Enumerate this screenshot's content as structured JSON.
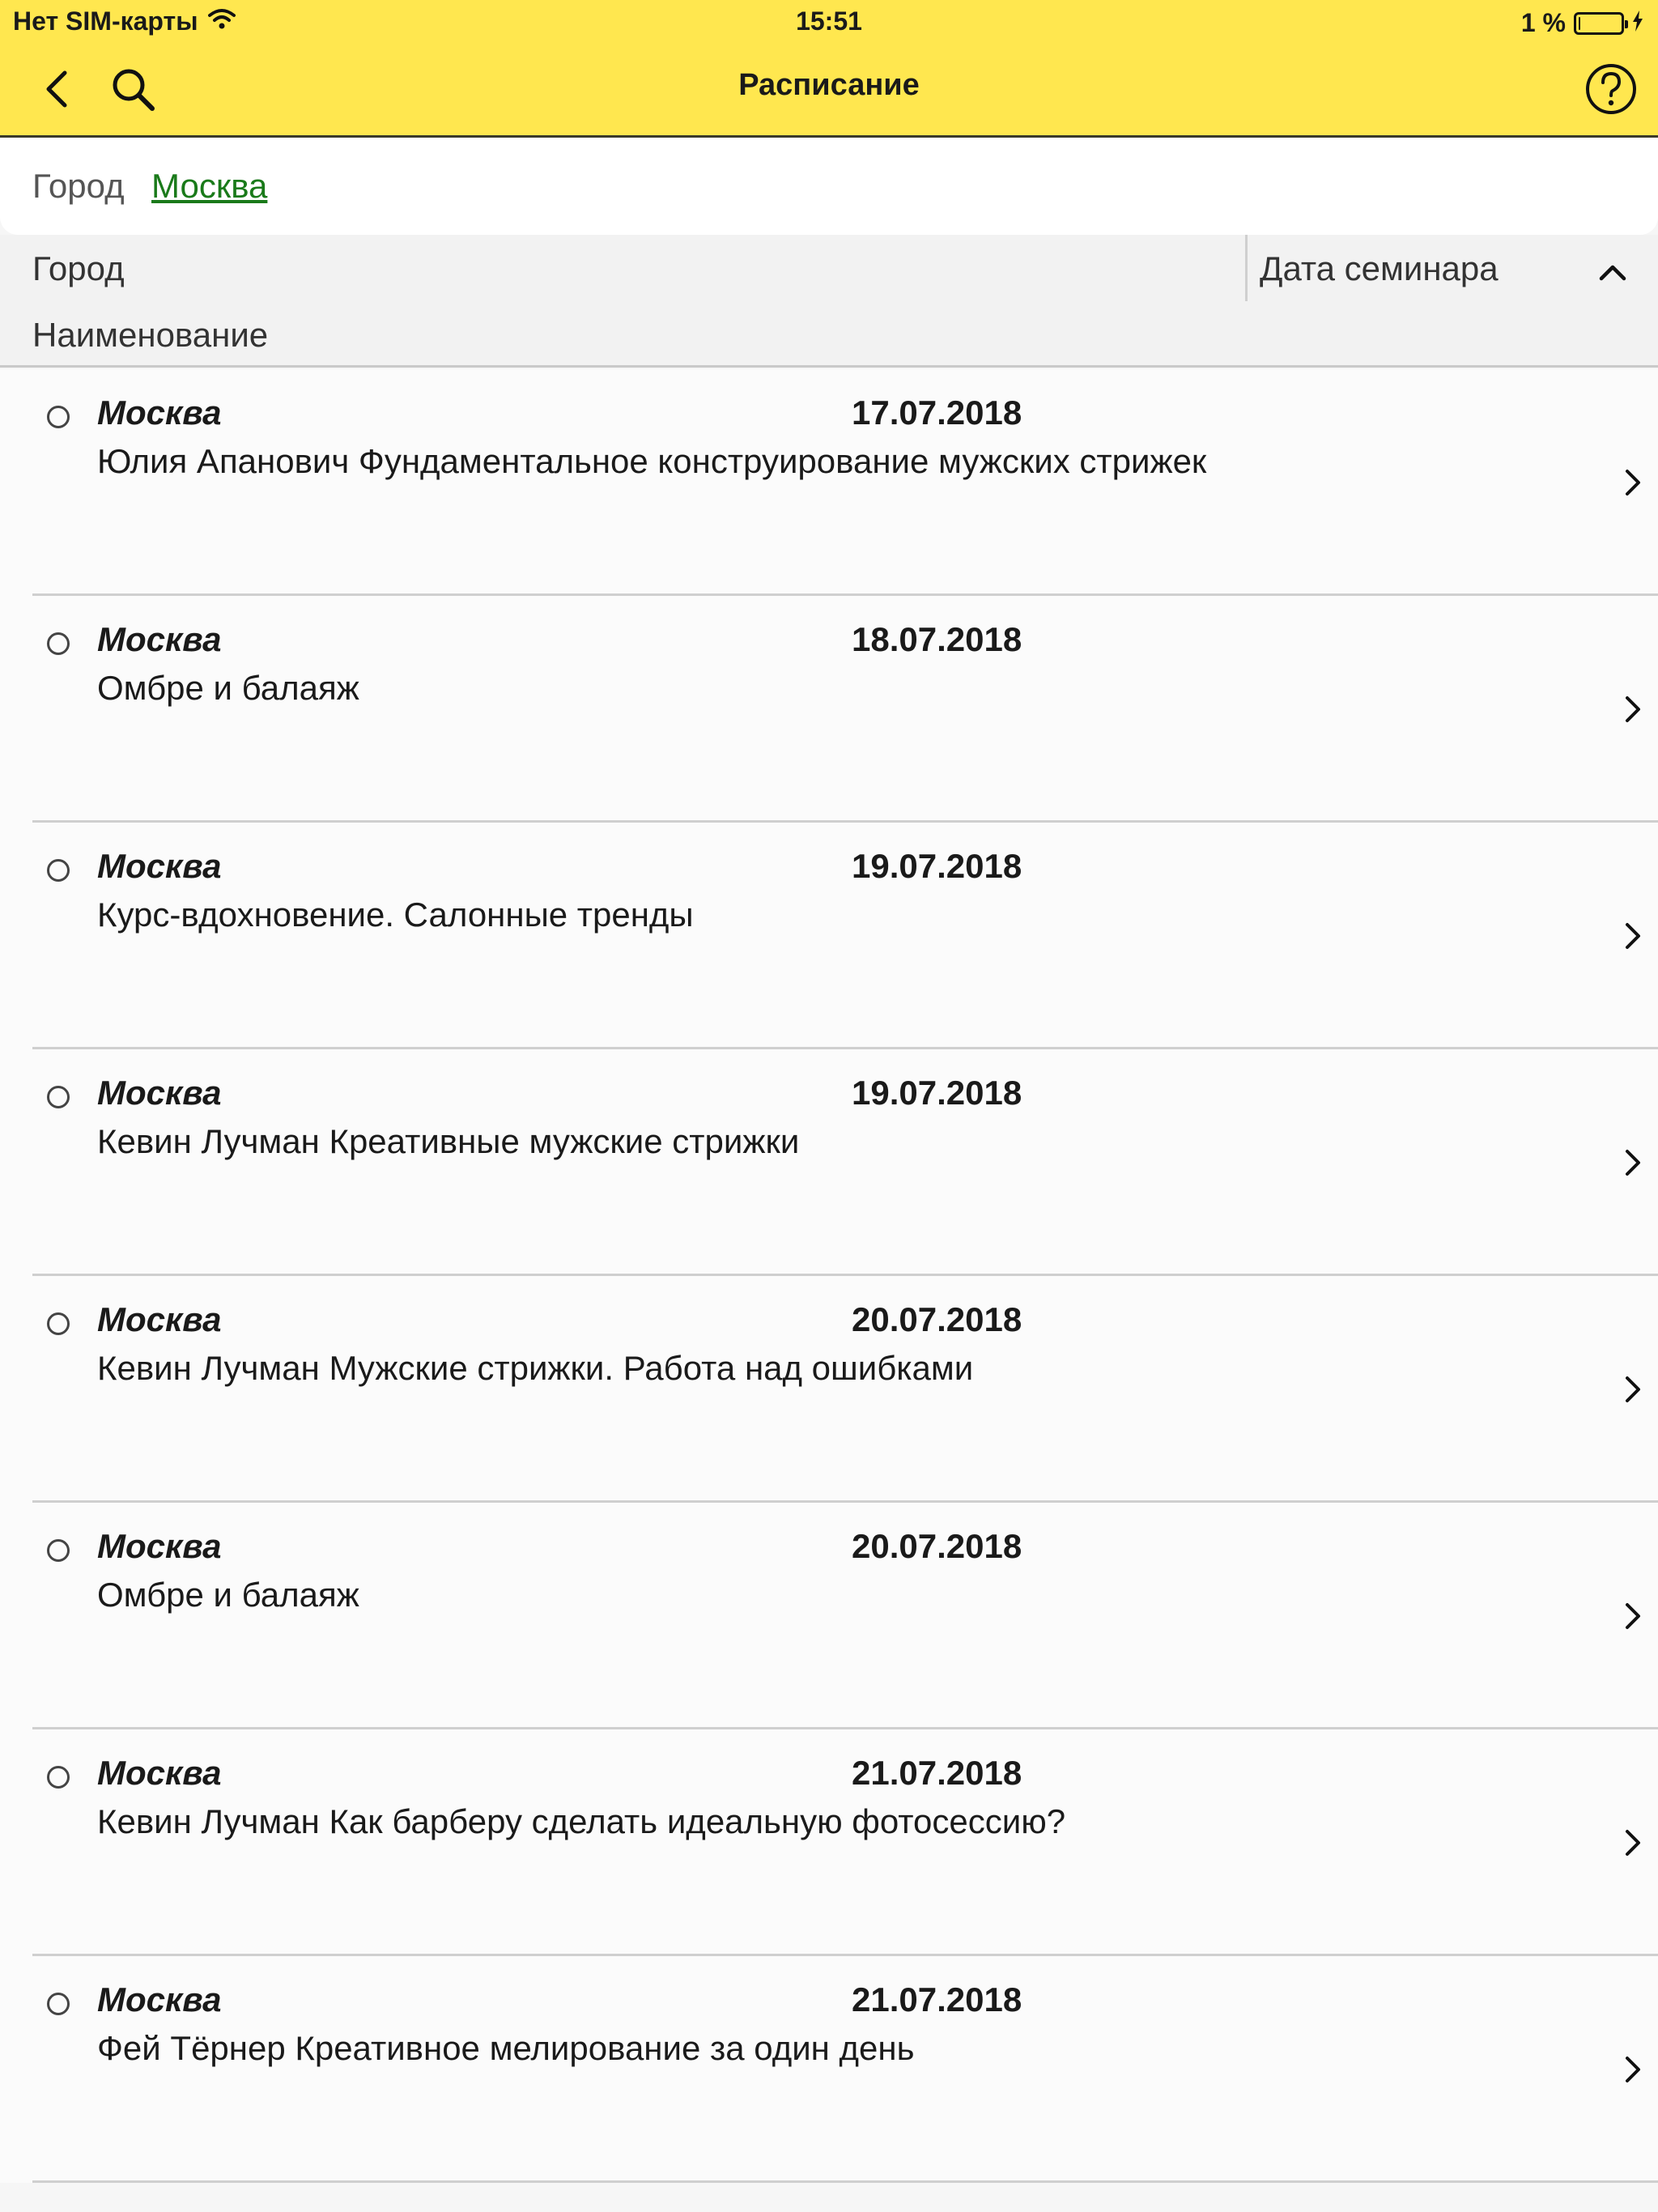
{
  "status_bar": {
    "carrier": "Нет SIM-карты",
    "time": "15:51",
    "battery": "1 %",
    "battery_level": 0.01
  },
  "nav": {
    "title": "Расписание",
    "icons": {
      "back": "chevron-left-icon",
      "search": "search-icon",
      "help": "help-icon"
    }
  },
  "filter": {
    "label": "Город",
    "value": "Москва"
  },
  "columns": {
    "city": "Город",
    "date": "Дата семинара",
    "name": "Наименование",
    "sort_icon": "chevron-up-icon"
  },
  "rows": [
    {
      "city": "Москва",
      "date": "17.07.2018",
      "name": "Юлия Апанович Фундаментальное конструирование мужских стрижек"
    },
    {
      "city": "Москва",
      "date": "18.07.2018",
      "name": "Омбре и балаяж"
    },
    {
      "city": "Москва",
      "date": "19.07.2018",
      "name": "Курс-вдохновение. Салонные тренды"
    },
    {
      "city": "Москва",
      "date": "19.07.2018",
      "name": "Кевин Лучман Креативные мужские стрижки"
    },
    {
      "city": "Москва",
      "date": "20.07.2018",
      "name": "Кевин Лучман Мужские стрижки. Работа над ошибками"
    },
    {
      "city": "Москва",
      "date": "20.07.2018",
      "name": "Омбре и балаяж"
    },
    {
      "city": "Москва",
      "date": "21.07.2018",
      "name": "Кевин Лучман Как барберу сделать идеальную фотосессию?"
    },
    {
      "city": "Москва",
      "date": "21.07.2018",
      "name": "Фей Тёрнер Креативное мелирование за один день"
    }
  ],
  "colors": {
    "nav_bg": "#ffe74f",
    "link": "#1a7a1a"
  }
}
